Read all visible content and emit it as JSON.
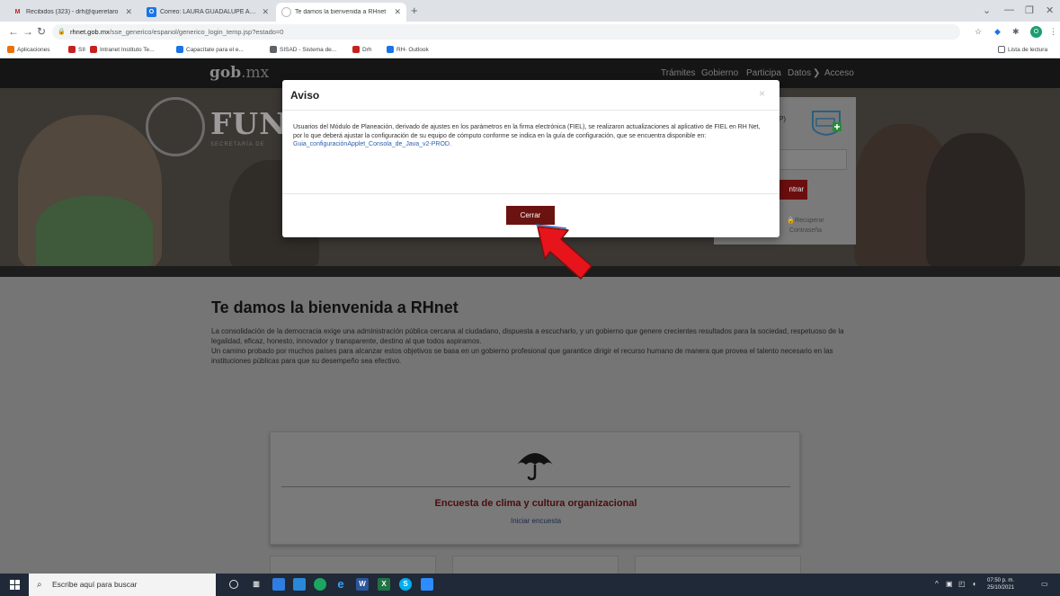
{
  "browser": {
    "tabs": [
      {
        "label": "Recibidos (323) - drh@queretaro",
        "icon": "gmail-icon"
      },
      {
        "label": "Correo: LAURA GUADALUPE APO",
        "icon": "outlook-icon"
      },
      {
        "label": "Te damos la bienvenida a RHnet",
        "icon": "page-icon",
        "active": true
      }
    ],
    "new_tab": "+",
    "url_host": "rhnet.gob.mx",
    "url_path": "/sse_generico/espanol/generico_login_temp.jsp?estado=0",
    "profile_initial": "O",
    "bookmarks": [
      {
        "label": "Aplicaciones",
        "icon": "apps-grid-icon",
        "color": "#e8710a"
      },
      {
        "label": "SII",
        "icon": "sii-icon",
        "color": "#c5221f"
      },
      {
        "label": "Intranet Instituto Te...",
        "icon": "intranet-icon",
        "color": "#c5221f"
      },
      {
        "label": "Capacítate para el e...",
        "icon": "capacitate-icon",
        "color": "#1a73e8"
      },
      {
        "label": "SISAD - Sistema de...",
        "icon": "sisad-icon",
        "color": "#5f6368"
      },
      {
        "label": "Drh",
        "icon": "gmail-icon",
        "color": "#c5221f"
      },
      {
        "label": "RH- Outlook",
        "icon": "outlook-icon",
        "color": "#1a73e8"
      }
    ],
    "reading_list": "Lista de lectura"
  },
  "site": {
    "logo_main": "gob",
    "logo_suffix": ".mx",
    "nav": [
      "Trámites",
      "Gobierno",
      "Participa",
      "Datos"
    ],
    "nav_acceso": "Acceso",
    "nav_chevron": "❯",
    "hero_title": "FUN",
    "hero_sub": "SECRETARÍA DE",
    "login_label": "P)",
    "login_button": "ntrar",
    "login_recover": "Recuperar Contraseña"
  },
  "welcome": {
    "title": "Te damos la bienvenida a RHnet",
    "p1": "La consolidación de la democracia exige una administración pública cercana al ciudadano, dispuesta a escucharlo, y un gobierno que genere crecientes resultados para la sociedad, respetuoso de la legalidad, eficaz, honesto, innovador y transparente, destino al que todos aspiramos.",
    "p2": "Un camino probado por muchos países para alcanzar estos objetivos se basa en un gobierno profesional que garantice dirigir el recurso humano de manera que provea el talento necesario en las instituciones públicas para que su desempeño sea efectivo."
  },
  "card": {
    "title": "Encuesta de clima y cultura organizacional",
    "link": "Iniciar encuesta"
  },
  "modal": {
    "title": "Aviso",
    "close": "×",
    "body": "Usuarios del Módulo de Planeación, derivado de ajustes en los parámetros en la firma electrónica (FIEL), se realizaron actualizaciones al aplicativo de FIEL en RH Net, por lo que deberá ajustar la configuración de su equipo de cómputo conforme se indica en la guía de configuración, que se encuentra disponible en:",
    "link": "Guia_configuraciónApplet_Consola_de_Java_v2-PROD.",
    "button": "Cerrar"
  },
  "taskbar": {
    "search_placeholder": "Escribe aquí para buscar",
    "time": "07:50 p. m.",
    "date": "25/10/2021"
  },
  "colors": {
    "modal_button": "#6b1310",
    "arrow": "#e8141b",
    "login_button": "#6b0e0e"
  }
}
